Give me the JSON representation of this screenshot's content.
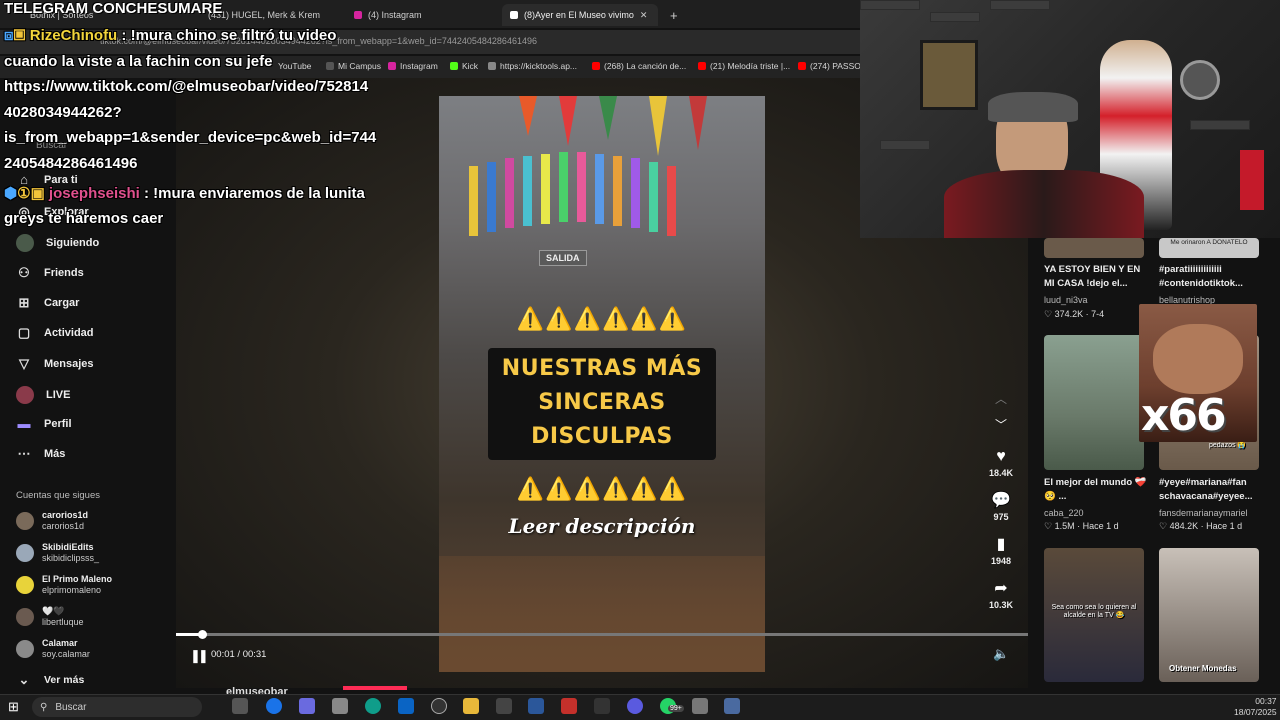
{
  "browser": {
    "tabs": [
      "Bothix | Sorteos",
      "(431) HUGEL, Merk & Krem",
      "(4) Instagram",
      "(8)Ayer en El Museo vivimo"
    ],
    "new_tab": "+",
    "url": "tiktok.com/@elmuseobar/video/7528144028034944262?is_from_webapp=1&web_id=7442405484286461496",
    "bookmarks": [
      "YouTube",
      "Mi Campus",
      "Instagram",
      "Kick",
      "https://kicktools.ap...",
      "(268) La canción de...",
      "(21) Melodía triste |...",
      "(274) PASSO |"
    ]
  },
  "chat": {
    "header": "TELEGRAM CONCHESUMARE",
    "messages": [
      {
        "user": "RizeChinofu",
        "lines": [
          ": !mura chino se filtró tu video",
          "cuando la viste a la fachin con su jefe",
          "https://www.tiktok.com/@elmuseobar/video/752814",
          "4028034944262?",
          "is_from_webapp=1&sender_device=pc&web_id=744",
          "2405484286461496"
        ]
      },
      {
        "user": "josephseishi",
        "lines": [
          ": !mura enviaremos de la lunita",
          "greys te haremos caer"
        ]
      }
    ]
  },
  "sidebar": {
    "search_label": "Buscar",
    "items": [
      {
        "label": "Para ti",
        "icon": "home-icon"
      },
      {
        "label": "Explorar",
        "icon": "compass-icon"
      },
      {
        "label": "Siguiendo",
        "icon": "following-icon"
      },
      {
        "label": "Friends",
        "icon": "friends-icon"
      },
      {
        "label": "Cargar",
        "icon": "upload-icon"
      },
      {
        "label": "Actividad",
        "icon": "activity-icon"
      },
      {
        "label": "Mensajes",
        "icon": "messages-icon"
      },
      {
        "label": "LIVE",
        "icon": "live-icon"
      },
      {
        "label": "Perfil",
        "icon": "profile-icon"
      },
      {
        "label": "Más",
        "icon": "more-icon"
      }
    ],
    "following_title": "Cuentas que sigues",
    "accounts": [
      {
        "name": "carorios1d",
        "handle": "carorios1d",
        "color": "#7a6a5a"
      },
      {
        "name": "SkibidiEdits",
        "handle": "skibidiclipsss_",
        "color": "#9aa8b8"
      },
      {
        "name": "El Primo Maleno",
        "handle": "elprimomaleno",
        "color": "#e8d33a"
      },
      {
        "name": "🤍🖤",
        "handle": "libertluque",
        "color": "#6a5a50"
      },
      {
        "name": "Calamar",
        "handle": "soy.calamar",
        "color": "#8a8a8a"
      }
    ],
    "see_more": "Ver más"
  },
  "video": {
    "warning_line": "⚠️⚠️⚠️⚠️⚠️⚠️",
    "caption_lines": [
      "NUESTRAS MÁS",
      "SINCERAS",
      "DISCULPAS"
    ],
    "read_description": "Leer descripción",
    "sign": "SALIDA",
    "time": "00:01 / 00:31",
    "progress_fraction": 0.03,
    "author": "elmuseobar"
  },
  "actions": {
    "likes": "18.4K",
    "comments": "975",
    "saves": "1948",
    "shares": "10.3K"
  },
  "recommendations": [
    {
      "title": "YA ESTOY BIEN Y EN MI CASA !dejo el...",
      "user": "luud_ni3va",
      "stats": "♡ 374.2K · 7-4"
    },
    {
      "title": "#paratiiiiiiiiiiiii #contenidotiktok...",
      "user": "bellanutrishop",
      "stats": "",
      "overlay": "Me orinaron A DONATELO"
    },
    {
      "title": "El mejor del mundo ❤️‍🩹🥺 ...",
      "user": "caba_220",
      "stats": "♡ 1.5M · Hace 1 d"
    },
    {
      "title": "#yeye#mariana#fan schavacana#yeyee...",
      "user": "fansdemarianaymariel",
      "stats": "♡ 484.2K · Hace 1 d",
      "overlay": "pedazos 😭"
    },
    {
      "title": "",
      "user": "",
      "stats": "",
      "overlay": "Sea como sea lo quieren al alcalde en la TV 😂"
    },
    {
      "title": "",
      "user": "",
      "stats": "",
      "overlay": "Obtener Monedas"
    }
  ],
  "emote": {
    "text": "x66"
  },
  "taskbar": {
    "search": "Buscar",
    "badge": "99+",
    "time": "00:37",
    "date": "18/07/2025"
  }
}
